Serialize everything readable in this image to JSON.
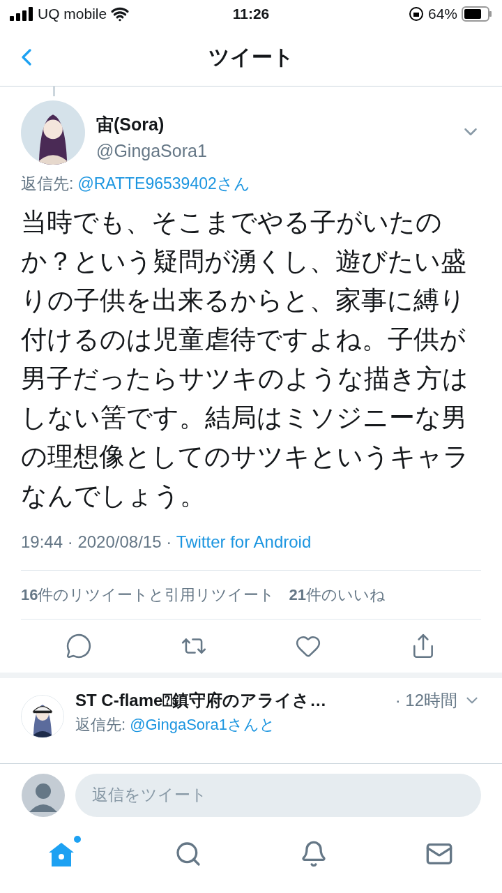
{
  "status_bar": {
    "carrier": "UQ mobile",
    "time": "11:26",
    "battery": "64%"
  },
  "header": {
    "title": "ツイート"
  },
  "tweet": {
    "name": "宙(Sora)",
    "handle": "@GingaSora1",
    "reply_label": "返信先:",
    "reply_to": "@RATTE96539402さん",
    "text": "当時でも、そこまでやる子がいたのか？という疑問が湧くし、遊びたい盛りの子供を出来るからと、家事に縛り付けるのは児童虐待ですよね。子供が男子だったらサツキのような描き方はしない筈です。結局はミソジニーな男の理想像としてのサツキというキャラなんでしょう。",
    "time": "19:44 · 2020/08/15 · ",
    "source": "Twitter for Android",
    "stats": [
      "**16**件のリツイートと引用リツイート",
      "**21**件のいいね"
    ]
  },
  "replies": [
    {
      "name": "ST C-flame⍰鎮守府のアライさ…",
      "time": "· 12時間",
      "reply_label": "返信先:",
      "reply_to": "@GingaSora1さんと"
    }
  ],
  "composer": {
    "placeholder": "返信をツイート"
  },
  "tabs": [
    {
      "kind": "home",
      "selected": true,
      "unread": true
    },
    {
      "kind": "search",
      "selected": false,
      "unread": false
    },
    {
      "kind": "notifications",
      "selected": false,
      "unread": false
    },
    {
      "kind": "messages",
      "selected": false,
      "unread": false
    }
  ]
}
